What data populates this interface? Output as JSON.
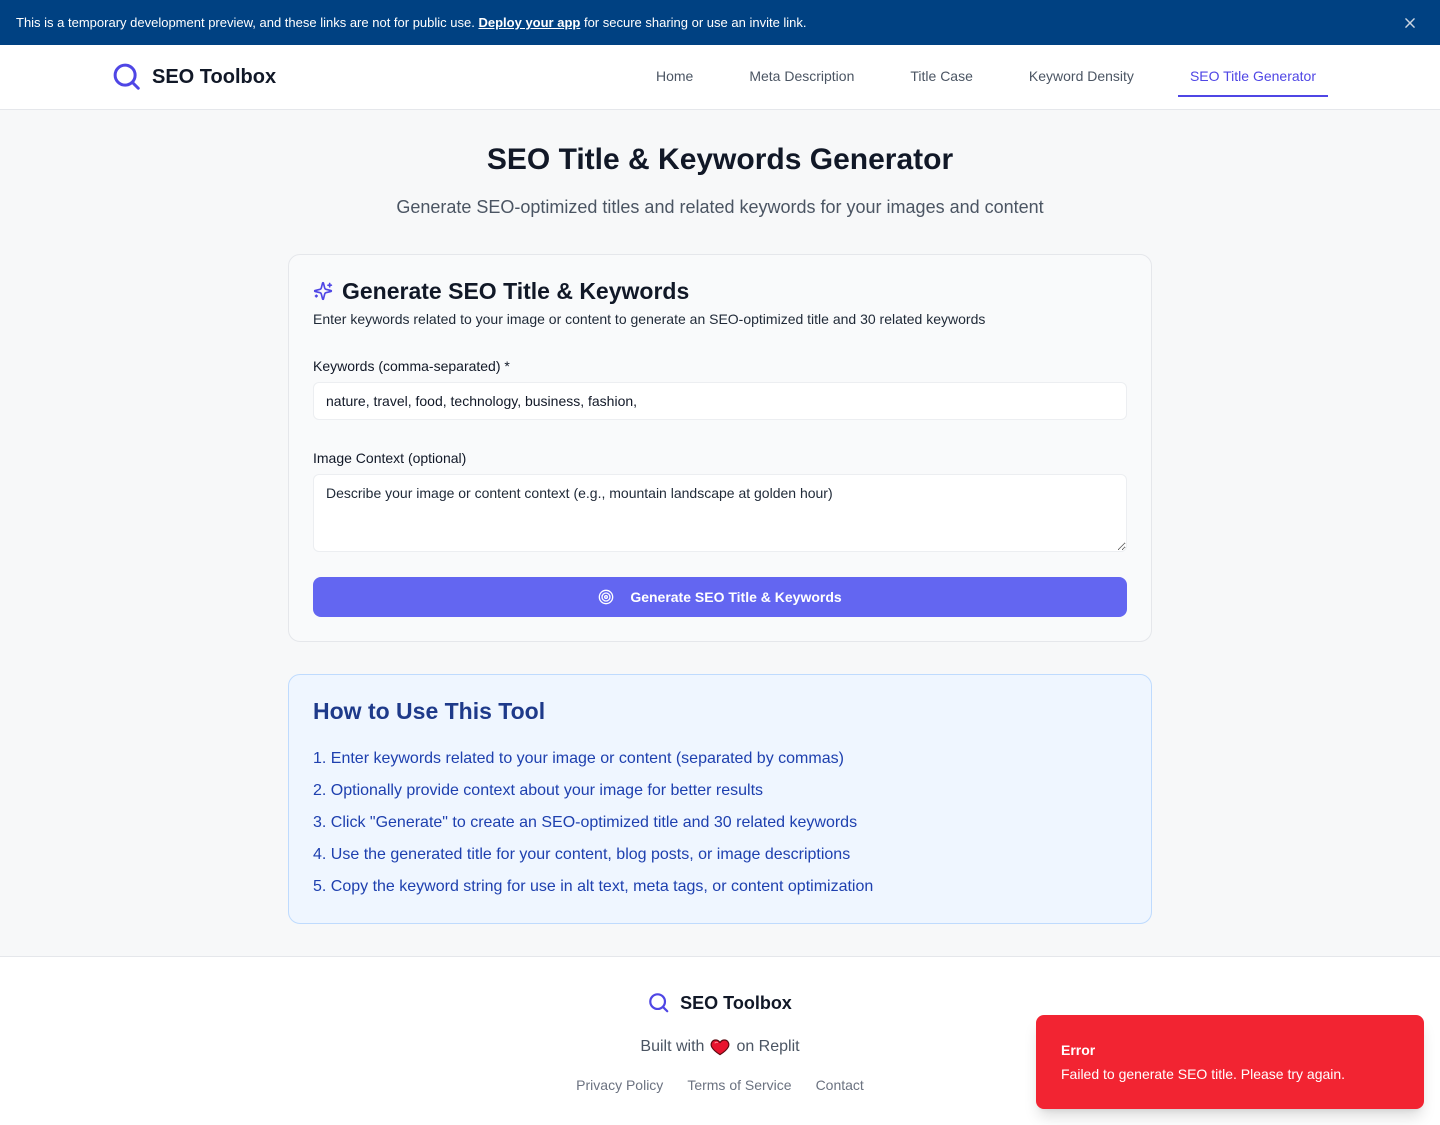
{
  "banner": {
    "text_before": "This is a temporary development preview, and these links are not for public use.",
    "link_label": "Deploy your app",
    "text_after": "for secure sharing or use an invite link.",
    "close_icon": "close-icon"
  },
  "header": {
    "logo_icon": "search-icon",
    "brand": "SEO Toolbox",
    "nav": [
      {
        "label": "Home",
        "active": false
      },
      {
        "label": "Meta Description",
        "active": false
      },
      {
        "label": "Title Case",
        "active": false
      },
      {
        "label": "Keyword Density",
        "active": false
      },
      {
        "label": "SEO Title Generator",
        "active": true
      }
    ]
  },
  "page": {
    "title": "SEO Title & Keywords Generator",
    "subtitle": "Generate SEO-optimized titles and related keywords for your images and content"
  },
  "form_card": {
    "icon": "sparkles-icon",
    "title": "Generate SEO Title & Keywords",
    "description": "Enter keywords related to your image or content to generate an SEO-optimized title and 30 related keywords",
    "keywords_label": "Keywords (comma-separated) *",
    "keywords_value": "nature, travel, food, technology, business, fashion,",
    "context_label": "Image Context (optional)",
    "context_placeholder": "Describe your image or content context (e.g., mountain landscape at golden hour)",
    "submit_icon": "target-icon",
    "submit_label": "Generate SEO Title & Keywords"
  },
  "howto": {
    "title": "How to Use This Tool",
    "steps": [
      "1. Enter keywords related to your image or content (separated by commas)",
      "2. Optionally provide context about your image for better results",
      "3. Click \"Generate\" to create an SEO-optimized title and 30 related keywords",
      "4. Use the generated title for your content, blog posts, or image descriptions",
      "5. Copy the keyword string for use in alt text, meta tags, or content optimization"
    ]
  },
  "footer": {
    "logo_icon": "search-icon",
    "brand": "SEO Toolbox",
    "built_with_before": "Built with",
    "heart_icon": "heart-icon",
    "built_with_after": "on Replit",
    "links": [
      "Privacy Policy",
      "Terms of Service",
      "Contact"
    ]
  },
  "toast": {
    "title": "Error",
    "message": "Failed to generate SEO title. Please try again."
  },
  "colors": {
    "banner_bg": "#004182",
    "accent": "#4f46e5",
    "button_bg": "#6366f1",
    "toast_bg": "#f22432",
    "howto_bg": "#eff6ff",
    "howto_border": "#bfdbfe",
    "howto_title": "#1e3a8a",
    "howto_text": "#1e40af",
    "page_bg": "#f7f8f9"
  }
}
